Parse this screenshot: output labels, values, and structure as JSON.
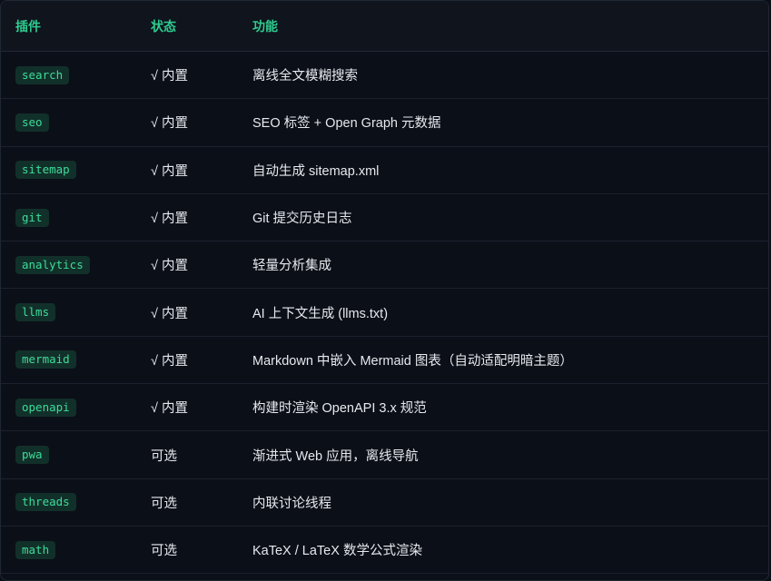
{
  "columns": [
    "插件",
    "状态",
    "功能"
  ],
  "rows": [
    {
      "plugin": "search",
      "status": "√ 内置",
      "feature": "离线全文模糊搜索"
    },
    {
      "plugin": "seo",
      "status": "√ 内置",
      "feature": "SEO 标签 + Open Graph 元数据"
    },
    {
      "plugin": "sitemap",
      "status": "√ 内置",
      "feature": "自动生成 sitemap.xml"
    },
    {
      "plugin": "git",
      "status": "√ 内置",
      "feature": "Git 提交历史日志"
    },
    {
      "plugin": "analytics",
      "status": "√ 内置",
      "feature": "轻量分析集成"
    },
    {
      "plugin": "llms",
      "status": "√ 内置",
      "feature": "AI 上下文生成 (llms.txt)"
    },
    {
      "plugin": "mermaid",
      "status": "√ 内置",
      "feature": "Markdown 中嵌入 Mermaid 图表（自动适配明暗主题）"
    },
    {
      "plugin": "openapi",
      "status": "√ 内置",
      "feature": "构建时渲染 OpenAPI 3.x 规范"
    },
    {
      "plugin": "pwa",
      "status": "可选",
      "feature": "渐进式 Web 应用，离线导航"
    },
    {
      "plugin": "threads",
      "status": "可选",
      "feature": "内联讨论线程"
    },
    {
      "plugin": "math",
      "status": "可选",
      "feature": "KaTeX / LaTeX 数学公式渲染"
    }
  ],
  "colors": {
    "accent": "#2ecc8f",
    "tag_bg": "#12302a",
    "background": "#0b0f18"
  }
}
